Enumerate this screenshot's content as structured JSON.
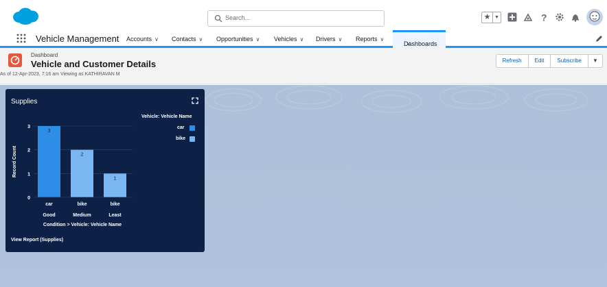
{
  "search": {
    "placeholder": "Search..."
  },
  "nav": {
    "app_name": "Vehicle Management",
    "items": [
      {
        "label": "Accounts"
      },
      {
        "label": "Contacts"
      },
      {
        "label": "Opportunities"
      },
      {
        "label": "Vehicles"
      },
      {
        "label": "Drivers"
      },
      {
        "label": "Reports"
      }
    ],
    "active": "Dashboards"
  },
  "page": {
    "eyebrow": "Dashboard",
    "title": "Vehicle and Customer Details",
    "meta": "As of 12-Apr-2023, 7:16 am Viewing as KATHIRAVAN M",
    "buttons": {
      "refresh": "Refresh",
      "edit": "Edit",
      "subscribe": "Subscribe"
    }
  },
  "colors": {
    "brand": "#1b96ff",
    "widget_bg": "#0c2145",
    "canvas_bg": "#acc0d9",
    "car": "#2e8de6",
    "bike": "#79b6f2"
  },
  "widget": {
    "title": "Supplies",
    "legend_title": "Vehicle: Vehicle Name",
    "view_report": "View Report (Supplies)",
    "icons": {
      "expand": "expand-icon"
    }
  },
  "chart_data": {
    "type": "bar",
    "ylabel": "Record Count",
    "xlabel": "Condition > Vehicle: Vehicle Name",
    "ylim": [
      0,
      3
    ],
    "yticks": [
      "0",
      "1",
      "2",
      "3"
    ],
    "categories": [
      {
        "label": "car",
        "group": "Good",
        "value": 3,
        "series": "car"
      },
      {
        "label": "bike",
        "group": "Medium",
        "value": 2,
        "series": "bike"
      },
      {
        "label": "bike",
        "group": "Least",
        "value": 1,
        "series": "bike"
      }
    ],
    "legend": [
      {
        "name": "car"
      },
      {
        "name": "bike"
      }
    ],
    "legend_position": "top-right"
  }
}
